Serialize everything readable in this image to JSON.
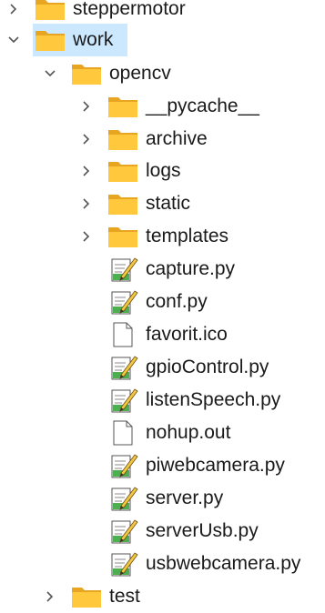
{
  "tree": [
    {
      "label": "steppermotor",
      "type": "folder",
      "expanded": false,
      "selected": false,
      "depth": 0,
      "chevron": "chevron-right"
    },
    {
      "label": "work",
      "type": "folder",
      "expanded": true,
      "selected": true,
      "depth": 0,
      "chevron": "chevron-down"
    },
    {
      "label": "opencv",
      "type": "folder",
      "expanded": true,
      "selected": false,
      "depth": 1,
      "chevron": "chevron-down"
    },
    {
      "label": "__pycache__",
      "type": "folder",
      "expanded": false,
      "selected": false,
      "depth": 2,
      "chevron": "chevron-right"
    },
    {
      "label": "archive",
      "type": "folder",
      "expanded": false,
      "selected": false,
      "depth": 2,
      "chevron": "chevron-right"
    },
    {
      "label": "logs",
      "type": "folder",
      "expanded": false,
      "selected": false,
      "depth": 2,
      "chevron": "chevron-right"
    },
    {
      "label": "static",
      "type": "folder",
      "expanded": false,
      "selected": false,
      "depth": 2,
      "chevron": "chevron-right"
    },
    {
      "label": "templates",
      "type": "folder",
      "expanded": false,
      "selected": false,
      "depth": 2,
      "chevron": "chevron-right"
    },
    {
      "label": "capture.py",
      "type": "python-file",
      "depth": 2
    },
    {
      "label": "conf.py",
      "type": "python-file",
      "depth": 2
    },
    {
      "label": "favorit.ico",
      "type": "file",
      "depth": 2
    },
    {
      "label": "gpioControl.py",
      "type": "python-file",
      "depth": 2
    },
    {
      "label": "listenSpeech.py",
      "type": "python-file",
      "depth": 2
    },
    {
      "label": "nohup.out",
      "type": "file",
      "depth": 2
    },
    {
      "label": "piwebcamera.py",
      "type": "python-file",
      "depth": 2
    },
    {
      "label": "server.py",
      "type": "python-file",
      "depth": 2
    },
    {
      "label": "serverUsb.py",
      "type": "python-file",
      "depth": 2
    },
    {
      "label": "usbwebcamera.py",
      "type": "python-file",
      "depth": 2
    },
    {
      "label": "test",
      "type": "folder",
      "expanded": false,
      "selected": false,
      "depth": 1,
      "chevron": "chevron-right"
    }
  ],
  "colors": {
    "selection": "#cce8ff",
    "folder_back": "#e8a521",
    "folder_front": "#ffc83d",
    "python_green": "#4caf50",
    "chevron": "#555555"
  }
}
